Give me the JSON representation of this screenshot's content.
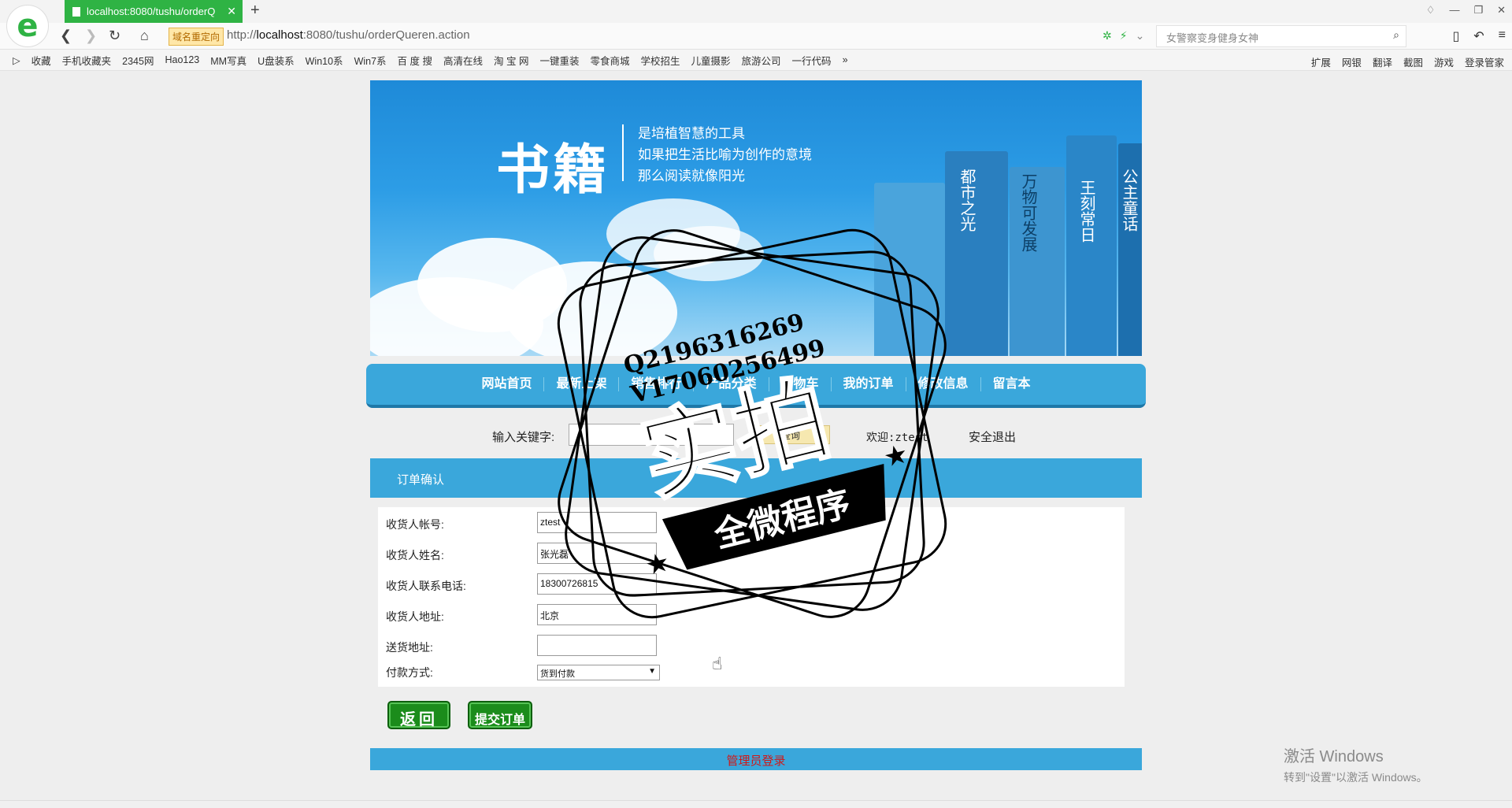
{
  "browser": {
    "tab_title": "localhost:8080/tushu/orderQ",
    "redirect_badge": "域名重定向",
    "url_prefix": "http://",
    "url_host": "localhost",
    "url_rest": ":8080/tushu/orderQueren.action",
    "search_placeholder": "女警察变身健身女神",
    "bookmarks": [
      "收藏",
      "手机收藏夹",
      "2345网",
      "Hao123",
      "MM写真",
      "U盘装系",
      "Win10系",
      "Win7系",
      "百 度 搜",
      "高清在线",
      "淘 宝 网",
      "一键重装",
      "零食商城",
      "学校招生",
      "儿童摄影",
      "旅游公司",
      "一行代码"
    ],
    "bookmarks_right": [
      "扩展",
      "网银",
      "翻译",
      "截图",
      "游戏",
      "登录管家"
    ]
  },
  "banner": {
    "title": "书籍",
    "lines": [
      "是培植智慧的工具",
      "如果把生活比喻为创作的意境",
      "那么阅读就像阳光"
    ],
    "book_texts": [
      "都市之光",
      "万物可发展",
      "王刻常日",
      "公主童话"
    ]
  },
  "nav": {
    "items": [
      "网站首页",
      "最新上架",
      "销售排行",
      "产品分类",
      "购物车",
      "我的订单",
      "修改信息",
      "留言本"
    ]
  },
  "search": {
    "label": "输入关键字:",
    "button": "查询",
    "welcome": "欢迎:ztest",
    "logout": "安全退出"
  },
  "section": {
    "title": "订单确认"
  },
  "form": {
    "account_label": "收货人帐号:",
    "account_value": "ztest",
    "name_label": "收货人姓名:",
    "name_value": "张光磊",
    "phone_label": "收货人联系电话:",
    "phone_value": "18300726815",
    "address_label": "收货人地址:",
    "address_value": "北京",
    "delivery_label": "送货地址:",
    "delivery_value": "",
    "payment_label": "付款方式:",
    "payment_value": "货到付款"
  },
  "buttons": {
    "back": "返回",
    "submit": "提交订单"
  },
  "footer": {
    "admin_login": "管理员登录"
  },
  "watermark": {
    "line1": "Q2196316269",
    "line2": "V17060256499",
    "big": "实拍",
    "banner": "全微程序"
  },
  "windows": {
    "activate_title": "激活 Windows",
    "activate_sub": "转到\"设置\"以激活 Windows。"
  }
}
